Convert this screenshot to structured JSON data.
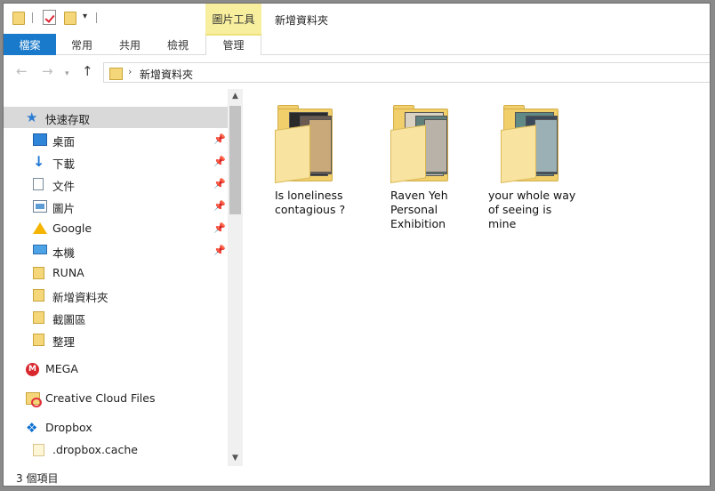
{
  "window": {
    "title": "新增資料夾",
    "context_tab_group": "圖片工具"
  },
  "ribbon": {
    "tabs": [
      {
        "label": "檔案",
        "active": true
      },
      {
        "label": "常用"
      },
      {
        "label": "共用"
      },
      {
        "label": "檢視"
      },
      {
        "label": "管理"
      }
    ]
  },
  "address": {
    "path": "新增資料夾"
  },
  "sidebar": {
    "quick_access": {
      "label": "快速存取",
      "icon": "star-icon"
    },
    "items": [
      {
        "label": "桌面",
        "icon": "desktop-icon",
        "pinned": true
      },
      {
        "label": "下載",
        "icon": "download-icon",
        "pinned": true
      },
      {
        "label": "文件",
        "icon": "document-icon",
        "pinned": true
      },
      {
        "label": "圖片",
        "icon": "pictures-icon",
        "pinned": true
      },
      {
        "label": "Google",
        "icon": "google-drive-icon",
        "pinned": true
      },
      {
        "label": "本機",
        "icon": "computer-icon",
        "pinned": true
      },
      {
        "label": "RUNA",
        "icon": "folder-icon"
      },
      {
        "label": "新增資料夾",
        "icon": "folder-icon"
      },
      {
        "label": "截圖區",
        "icon": "folder-icon"
      },
      {
        "label": "整理",
        "icon": "folder-icon"
      }
    ],
    "locations": [
      {
        "label": "MEGA",
        "icon": "mega-icon"
      },
      {
        "label": "Creative Cloud Files",
        "icon": "creative-cloud-icon"
      },
      {
        "label": "Dropbox",
        "icon": "dropbox-icon"
      },
      {
        "label": ".dropbox.cache",
        "icon": "file-icon"
      }
    ]
  },
  "folders": [
    {
      "name": "Is loneliness\ncontagious ?",
      "photo_colors": [
        "#2a2a2a",
        "#6b5a4f",
        "#c9a97a"
      ]
    },
    {
      "name": "Raven Yeh\nPersonal\nExhibition",
      "photo_colors": [
        "#d9d2c2",
        "#5e7f7a",
        "#b9b2a8"
      ]
    },
    {
      "name": "your whole way\nof seeing is\nmine",
      "photo_colors": [
        "#5f8a86",
        "#3b4a5a",
        "#9ab0b5"
      ]
    }
  ],
  "status": {
    "item_count": "3 個項目"
  }
}
